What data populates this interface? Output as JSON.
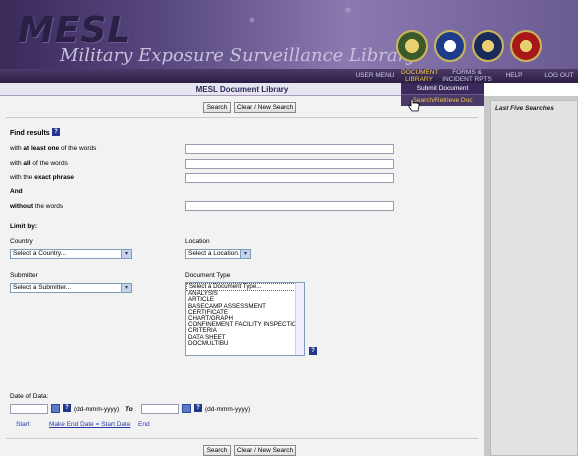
{
  "header": {
    "logo": "MESL",
    "subtitle": "Military Exposure Surveillance Library",
    "nav": {
      "user_menu": "USER MENU",
      "document_library": "DOCUMENT LIBRARY",
      "forms": "FORMS & INCIDENT RPTS",
      "help": "HELP",
      "logout": "LOG OUT"
    },
    "dropdown": [
      "Submit Document",
      "Search/Retrieve Doc"
    ]
  },
  "page_title": "MESL Document Library",
  "buttons": {
    "search": "Search",
    "clear": "Clear / New Search"
  },
  "find": {
    "heading": "Find results",
    "rows": [
      {
        "pre": "with ",
        "bold": "at least one",
        "post": " of the words",
        "value": ""
      },
      {
        "pre": "with ",
        "bold": "all",
        "post": " of the words",
        "value": ""
      },
      {
        "pre": "with the ",
        "bold": "exact phrase",
        "post": "",
        "value": ""
      },
      {
        "pre": "",
        "bold": "And",
        "post": "",
        "value": null
      },
      {
        "pre": "",
        "bold": "without",
        "post": " the words",
        "value": ""
      }
    ]
  },
  "limit": {
    "heading": "Limit by:",
    "country_label": "Country",
    "country_value": "Select a Country...",
    "location_label": "Location",
    "location_value": "Select a Location...",
    "submitter_label": "Submitter",
    "submitter_value": "Select a Submitter...",
    "doctype_label": "Document Type",
    "doctypes": [
      "Select a Document Type...",
      "ANALYSIS",
      "ARTICLE",
      "BASECAMP ASSESSMENT",
      "CERTIFICATE",
      "CHART/GRAPH",
      "CONFINEMENT FACILITY INSPECTION",
      "CRITERIA",
      "DATA SHEET",
      "DOCMULTIBU"
    ]
  },
  "date": {
    "label": "Date of Data:",
    "format": "(dd-mmm-yyyy)",
    "to": "To",
    "start": "Start",
    "make_end": "Make End Date = Start Date",
    "end": "End"
  },
  "right_panel": {
    "heading": "Last Five Searches"
  },
  "colors": {
    "brand": "#3a2a5a",
    "accent": "#f2c640",
    "link": "#2a3aa8"
  }
}
